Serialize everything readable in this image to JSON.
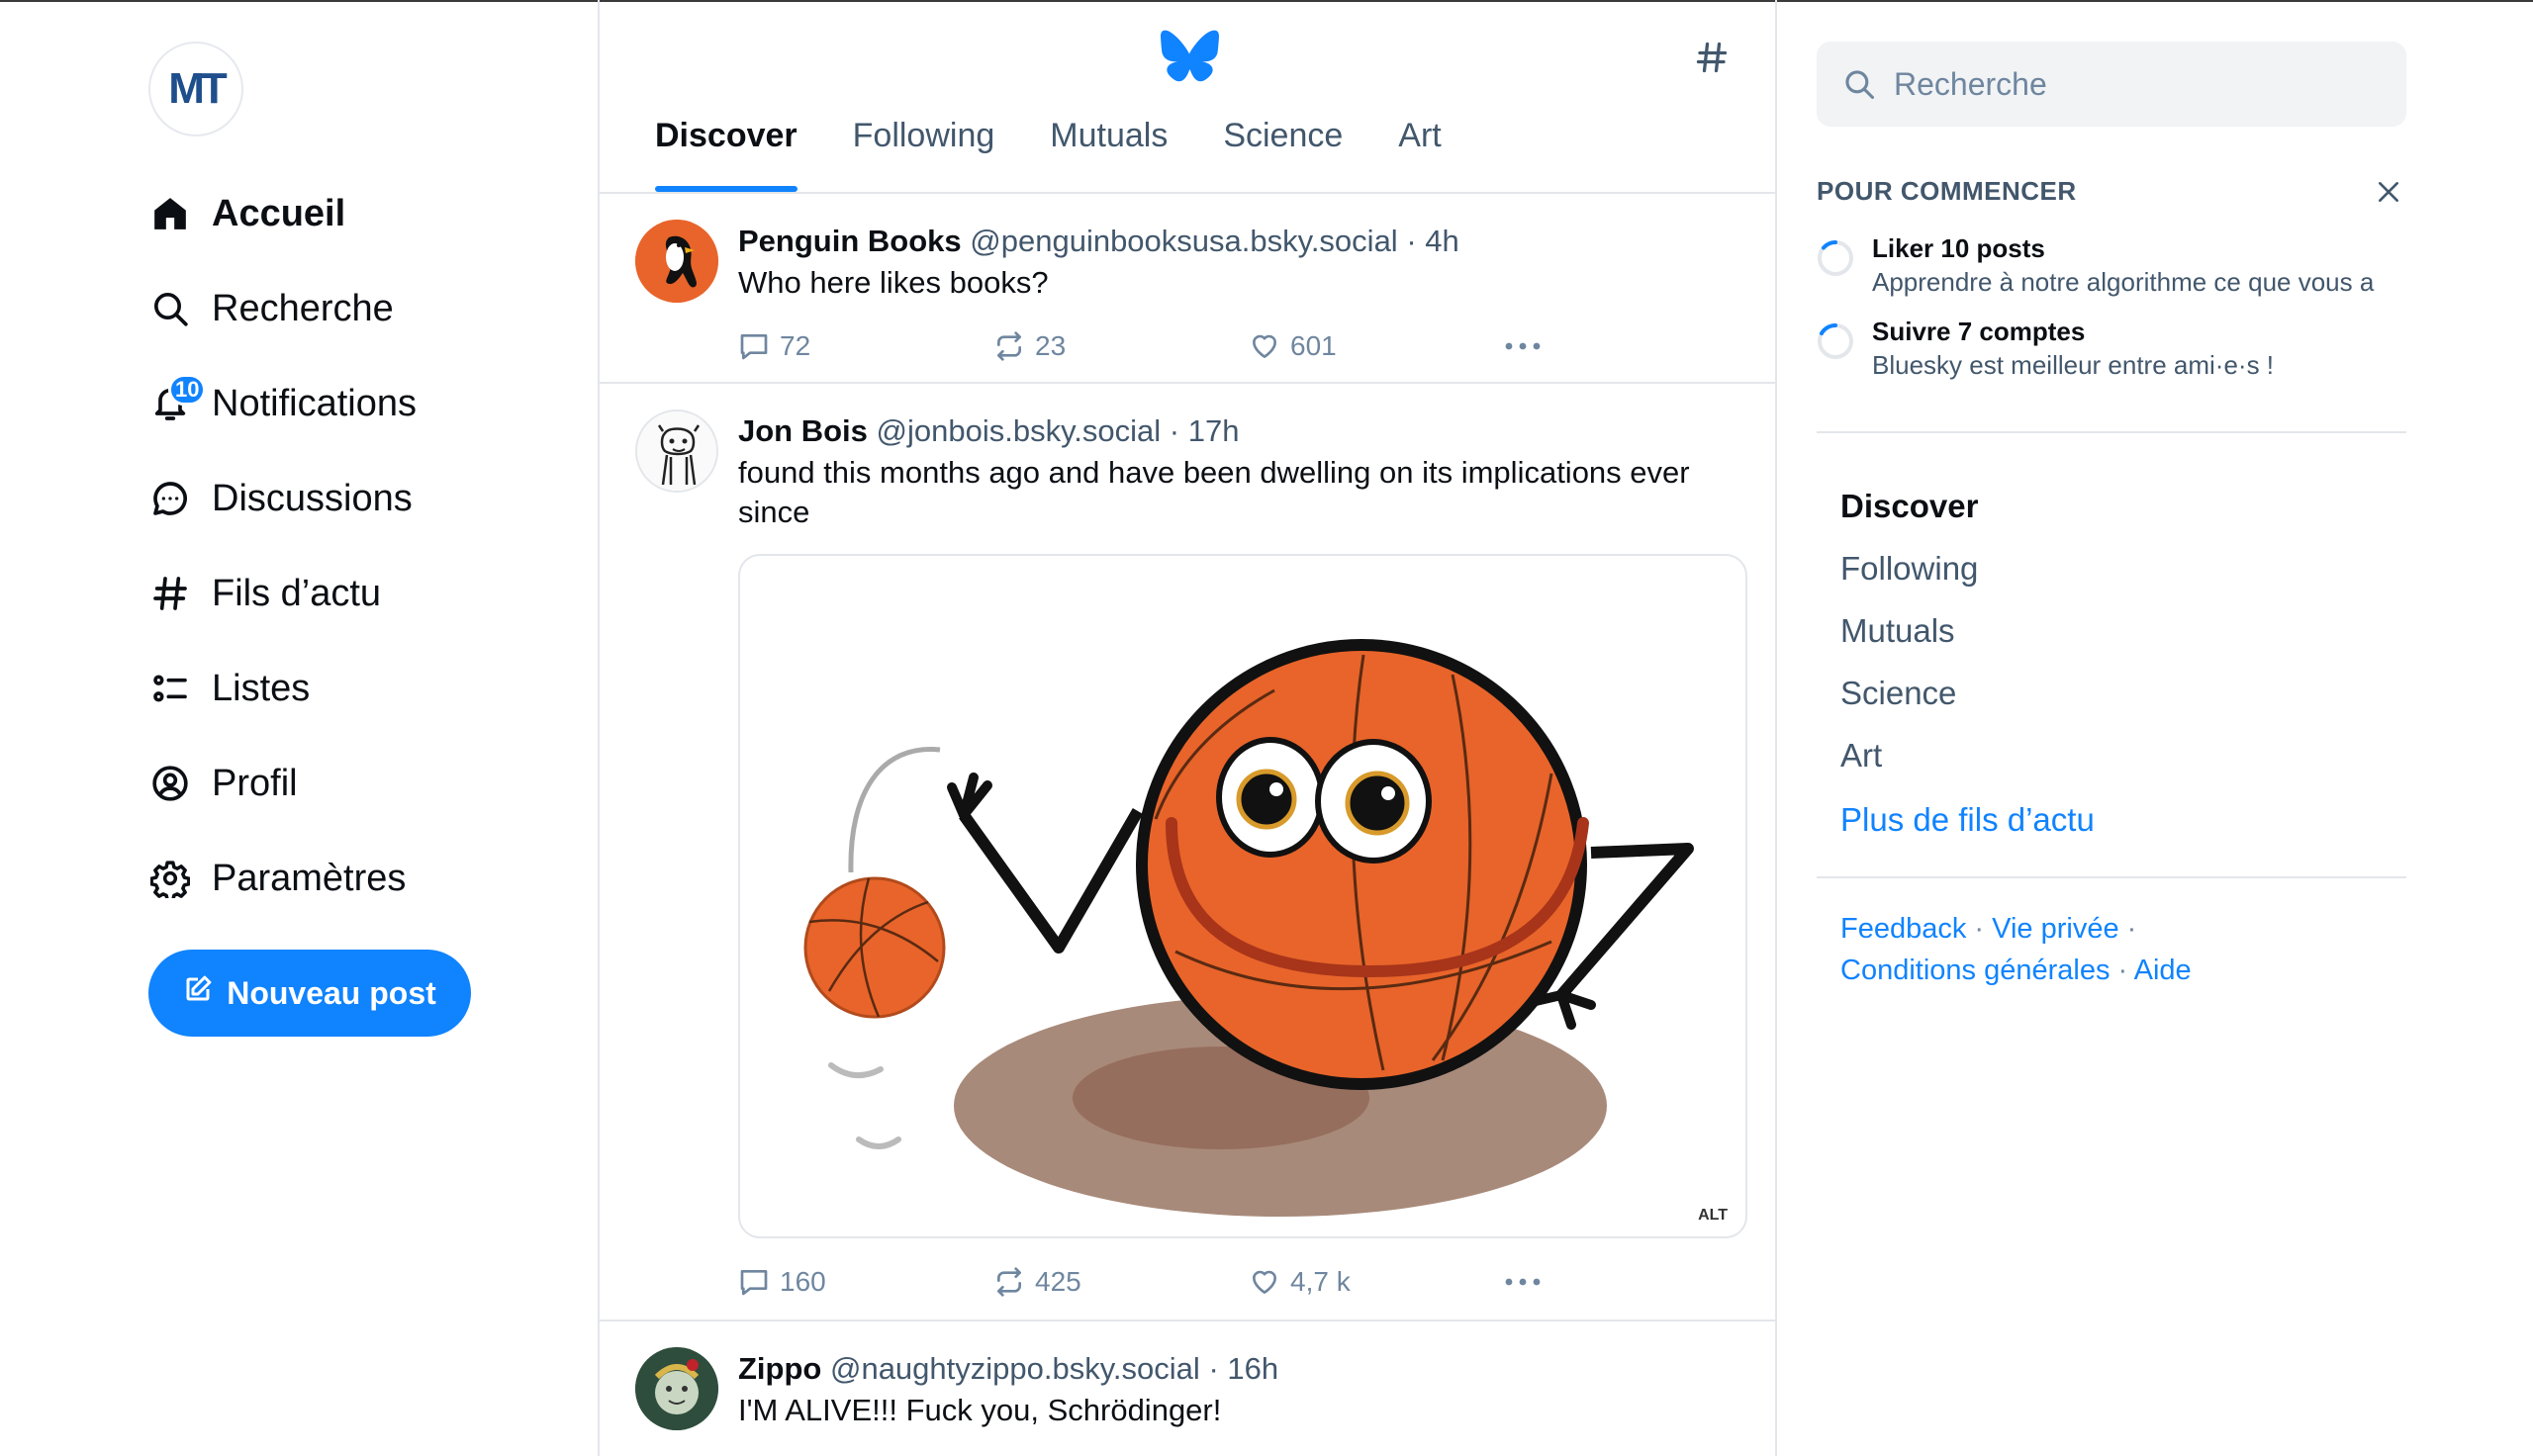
{
  "sidebar": {
    "avatar_initials": "MT",
    "nav": [
      {
        "label": "Accueil",
        "icon": "home-icon",
        "active": true
      },
      {
        "label": "Recherche",
        "icon": "search-icon"
      },
      {
        "label": "Notifications",
        "icon": "bell-icon",
        "badge": "10"
      },
      {
        "label": "Discussions",
        "icon": "chat-bubble-icon"
      },
      {
        "label": "Fils d’actu",
        "icon": "hash-icon"
      },
      {
        "label": "Listes",
        "icon": "list-icon"
      },
      {
        "label": "Profil",
        "icon": "user-circle-icon"
      },
      {
        "label": "Paramètres",
        "icon": "gear-icon"
      }
    ],
    "new_post_label": "Nouveau post"
  },
  "header": {
    "logo": "butterfly-icon",
    "tabs": [
      "Discover",
      "Following",
      "Mutuals",
      "Science",
      "Art"
    ],
    "active_tab": "Discover"
  },
  "posts": [
    {
      "name": "Penguin Books",
      "handle": "@penguinbooksusa.bsky.social",
      "time": "4h",
      "text": "Who here likes books?",
      "replies": "72",
      "reposts": "23",
      "likes": "601"
    },
    {
      "name": "Jon Bois",
      "handle": "@jonbois.bsky.social",
      "time": "17h",
      "text": "found this months ago and have been dwelling on its implications ever since",
      "image_alt_badge": "ALT",
      "replies": "160",
      "reposts": "425",
      "likes": "4,7 k"
    },
    {
      "name": "Zippo",
      "handle": "@naughtyzippo.bsky.social",
      "time": "16h",
      "text": "I'M ALIVE!!! Fuck you, Schrödinger!"
    }
  ],
  "right": {
    "search_placeholder": "Recherche",
    "start_title": "POUR COMMENCER",
    "tasks": [
      {
        "title": "Liker 10 posts",
        "subtitle": "Apprendre à notre algorithme ce que vous a"
      },
      {
        "title": "Suivre 7 comptes",
        "subtitle": "Bluesky est meilleur entre ami·e·s !"
      }
    ],
    "feeds": [
      "Discover",
      "Following",
      "Mutuals",
      "Science",
      "Art"
    ],
    "more_feeds": "Plus de fils d’actu",
    "footer": {
      "feedback": "Feedback",
      "privacy": "Vie privée",
      "terms": "Conditions générales",
      "help": "Aide",
      "sep": " · "
    }
  },
  "colors": {
    "accent": "#1083fe",
    "text": "#0b0f14",
    "muted": "#42576c",
    "border": "#e3e6ea"
  }
}
